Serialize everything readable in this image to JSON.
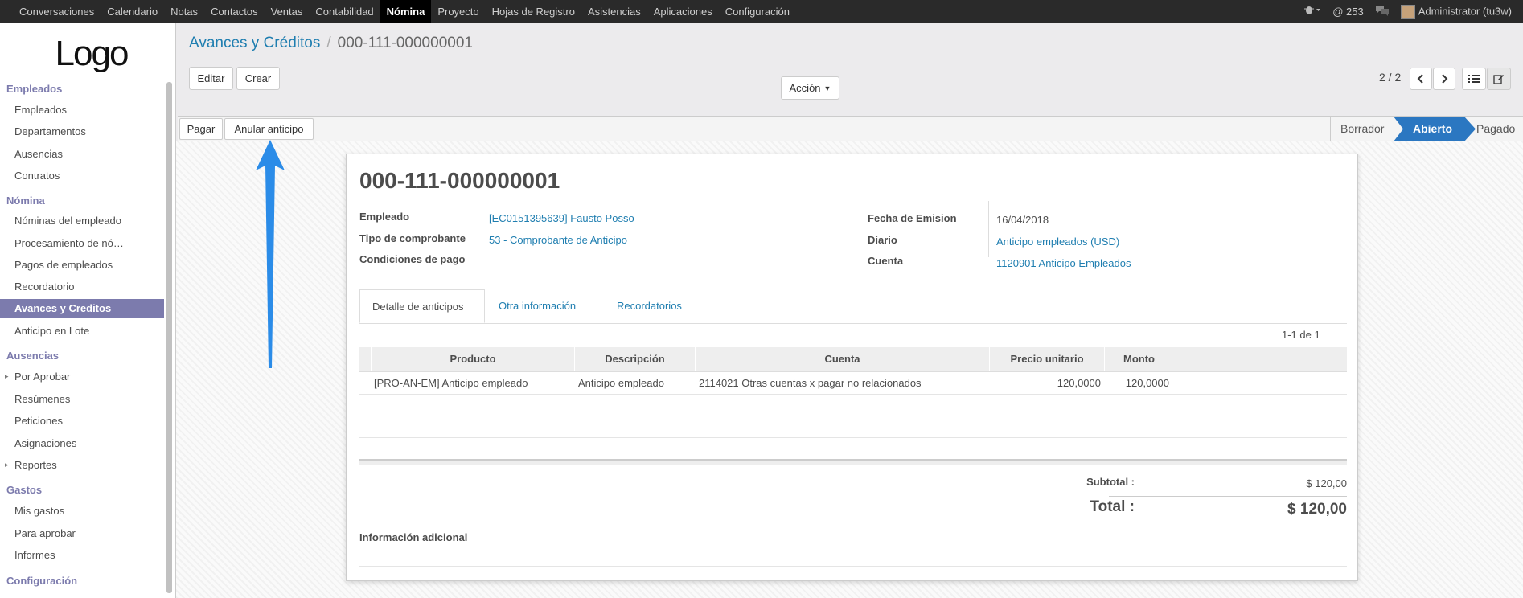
{
  "topbar": {
    "menu": [
      "Conversaciones",
      "Calendario",
      "Notas",
      "Contactos",
      "Ventas",
      "Contabilidad",
      "Nómina",
      "Proyecto",
      "Hojas de Registro",
      "Asistencias",
      "Aplicaciones",
      "Configuración"
    ],
    "active_index": 6,
    "messages_count": "@ 253",
    "user": "Administrator (tu3w)"
  },
  "sidebar": {
    "logo": "Logo",
    "sections": [
      {
        "title": "Empleados",
        "items": [
          "Empleados",
          "Departamentos",
          "Ausencias",
          "Contratos"
        ]
      },
      {
        "title": "Nómina",
        "items": [
          "Nóminas del empleado",
          "Procesamiento de nó…",
          "Pagos de empleados",
          "Recordatorio",
          "Avances y Creditos",
          "Anticipo en Lote"
        ]
      },
      {
        "title": "Ausencias",
        "items": [
          "Por Aprobar",
          "Resúmenes",
          "Peticiones",
          "Asignaciones",
          "Reportes"
        ]
      },
      {
        "title": "Gastos",
        "items": [
          "Mis gastos",
          "Para aprobar",
          "Informes"
        ]
      },
      {
        "title": "Configuración",
        "items": []
      }
    ]
  },
  "breadcrumb": {
    "parent": "Avances y Créditos",
    "current": "000-111-000000001"
  },
  "toolbar": {
    "edit": "Editar",
    "create": "Crear",
    "action": "Acción",
    "pager": "2 / 2"
  },
  "statusbar": {
    "pay": "Pagar",
    "cancel": "Anular anticipo",
    "stages": [
      "Borrador",
      "Abierto",
      "Pagado"
    ],
    "active_stage": "Abierto"
  },
  "form": {
    "title": "000-111-000000001",
    "left_fields": [
      {
        "label": "Empleado",
        "value": "[EC0151395639] Fausto Posso"
      },
      {
        "label": "Tipo de comprobante",
        "value": "53 - Comprobante de Anticipo"
      },
      {
        "label": "Condiciones de pago",
        "value": ""
      }
    ],
    "right_fields": [
      {
        "label": "Fecha de Emision",
        "value": "16/04/2018"
      },
      {
        "label": "Diario",
        "value": "Anticipo empleados (USD)"
      },
      {
        "label": "Cuenta",
        "value": "1120901 Anticipo Empleados"
      }
    ],
    "tabs": [
      "Detalle de anticipos",
      "Otra información",
      "Recordatorios"
    ],
    "record_count": "1-1 de 1",
    "columns": [
      "Producto",
      "Descripción",
      "Cuenta",
      "Precio unitario",
      "Monto"
    ],
    "rows": [
      [
        "[PRO-AN-EM] Anticipo empleado",
        "Anticipo empleado",
        "2114021 Otras cuentas x pagar no relacionados",
        "120,0000",
        "120,0000"
      ]
    ],
    "subtotal_label": "Subtotal :",
    "subtotal": "$ 120,00",
    "total_label": "Total :",
    "total": "$ 120,00",
    "additional_info": "Información adicional"
  },
  "colors": {
    "accent": "#7c7bad",
    "link": "#1f7eb0",
    "stage_active": "#2b77c1",
    "arrow": "#2b8ce8"
  }
}
